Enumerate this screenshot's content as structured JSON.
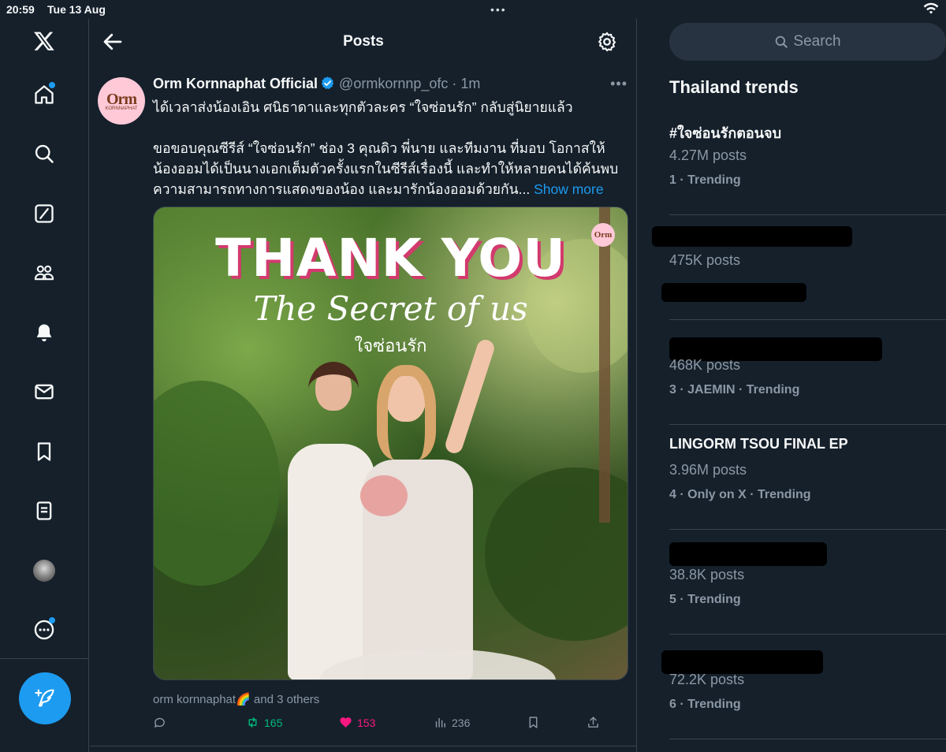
{
  "status_bar": {
    "time": "20:59",
    "date": "Tue 13 Aug",
    "dots": "•••"
  },
  "sidebar": {
    "items": [
      {
        "name": "x-logo"
      },
      {
        "name": "home"
      },
      {
        "name": "explore"
      },
      {
        "name": "grok"
      },
      {
        "name": "communities"
      },
      {
        "name": "notifications"
      },
      {
        "name": "messages"
      },
      {
        "name": "bookmarks"
      },
      {
        "name": "lists"
      },
      {
        "name": "profile"
      },
      {
        "name": "more"
      }
    ],
    "compose_icon": "feather-plus-icon"
  },
  "header": {
    "title": "Posts"
  },
  "tweet": {
    "author_name": "Orm Kornnaphat Official",
    "handle": "@ormkornnp_ofc",
    "separator": "·",
    "time": "1m",
    "more": "•••",
    "avatar_big": "Orm",
    "avatar_small": "KORNNAPHAT",
    "line1": "ได้เวลาส่งน้องเอิน ศนิธาดาและทุกตัวละคร “ใจซ่อนรัก” กลับสู่นิยายแล้ว",
    "line2": "ขอขอบคุณซีรีส์ “ใจซ่อนรัก” ช่อง 3 คุณดิว พี่นาย และทีมงาน ที่มอบ โอกาสให้",
    "line3": "น้องออมได้เป็นนางเอกเต็มตัวครั้งแรกในซีรีส์เรื่องนี้ และทำให้หลายคนได้ค้นพบ",
    "line4": "ความสามารถทางการแสดงของน้อง และมารักน้องออมด้วยกัน...",
    "show_more": "Show more",
    "media": {
      "headline": "THANK YOU",
      "script": "The Secret of us",
      "thai_logo": "ใจซ่อนรัก",
      "badge": "Orm"
    },
    "likers": "orm kornnaphat🌈 and 3 others",
    "actions": {
      "reply": "",
      "retweets": "165",
      "likes": "153",
      "views": "236"
    }
  },
  "search": {
    "placeholder": "Search"
  },
  "trends": {
    "title": "Thailand trends",
    "items": [
      {
        "name": "#ใจซ่อนรักตอนจบ",
        "count": "4.27M posts",
        "meta": "1 · Trending"
      },
      {
        "name": "",
        "count": "475K posts",
        "meta": ""
      },
      {
        "name": "",
        "count": "468K posts",
        "meta": "3 · JAEMIN · Trending"
      },
      {
        "name": "LINGORM TSOU FINAL EP",
        "count": "3.96M posts",
        "meta": "4 · Only on X · Trending"
      },
      {
        "name": "",
        "count": "38.8K posts",
        "meta": "5 · Trending"
      },
      {
        "name": "",
        "count": "72.2K posts",
        "meta": "6 · Trending"
      }
    ]
  },
  "colors": {
    "background": "#15202b",
    "accent": "#1d9bf0",
    "like": "#f91880",
    "retweet": "#00ba7c",
    "muted": "#8b98a5"
  }
}
